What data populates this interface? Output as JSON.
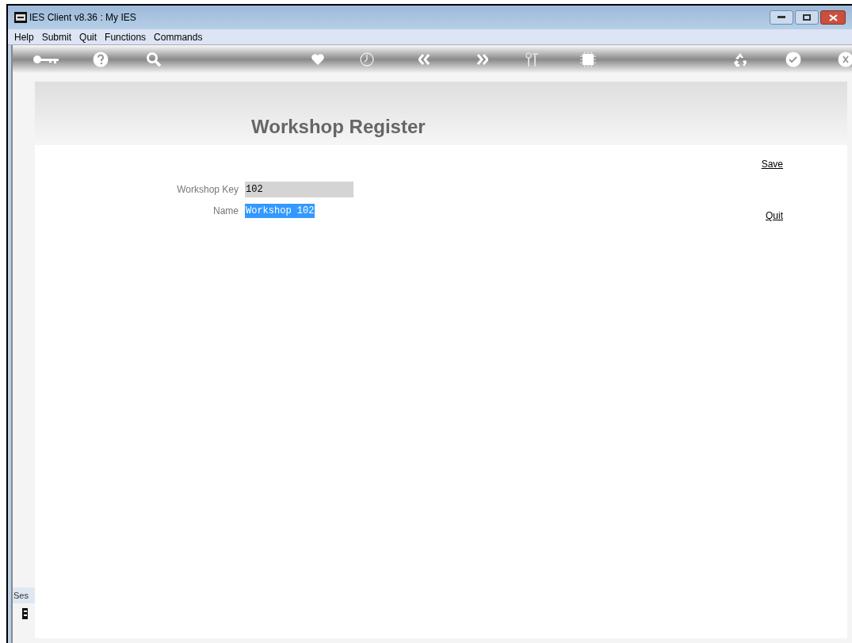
{
  "window": {
    "title": "IES Client v8.36 : My IES"
  },
  "menu": [
    "Help",
    "Submit",
    "Quit",
    "Functions",
    "Commands"
  ],
  "page": {
    "title": "Workshop Register"
  },
  "fields": [
    {
      "label": "Workshop Key",
      "value": "102",
      "selected": false
    },
    {
      "label": "Name",
      "value": "Workshop 102",
      "selected": true
    }
  ],
  "actions": [
    "Save",
    "Quit"
  ],
  "side_panel": {
    "label": "Ses"
  }
}
